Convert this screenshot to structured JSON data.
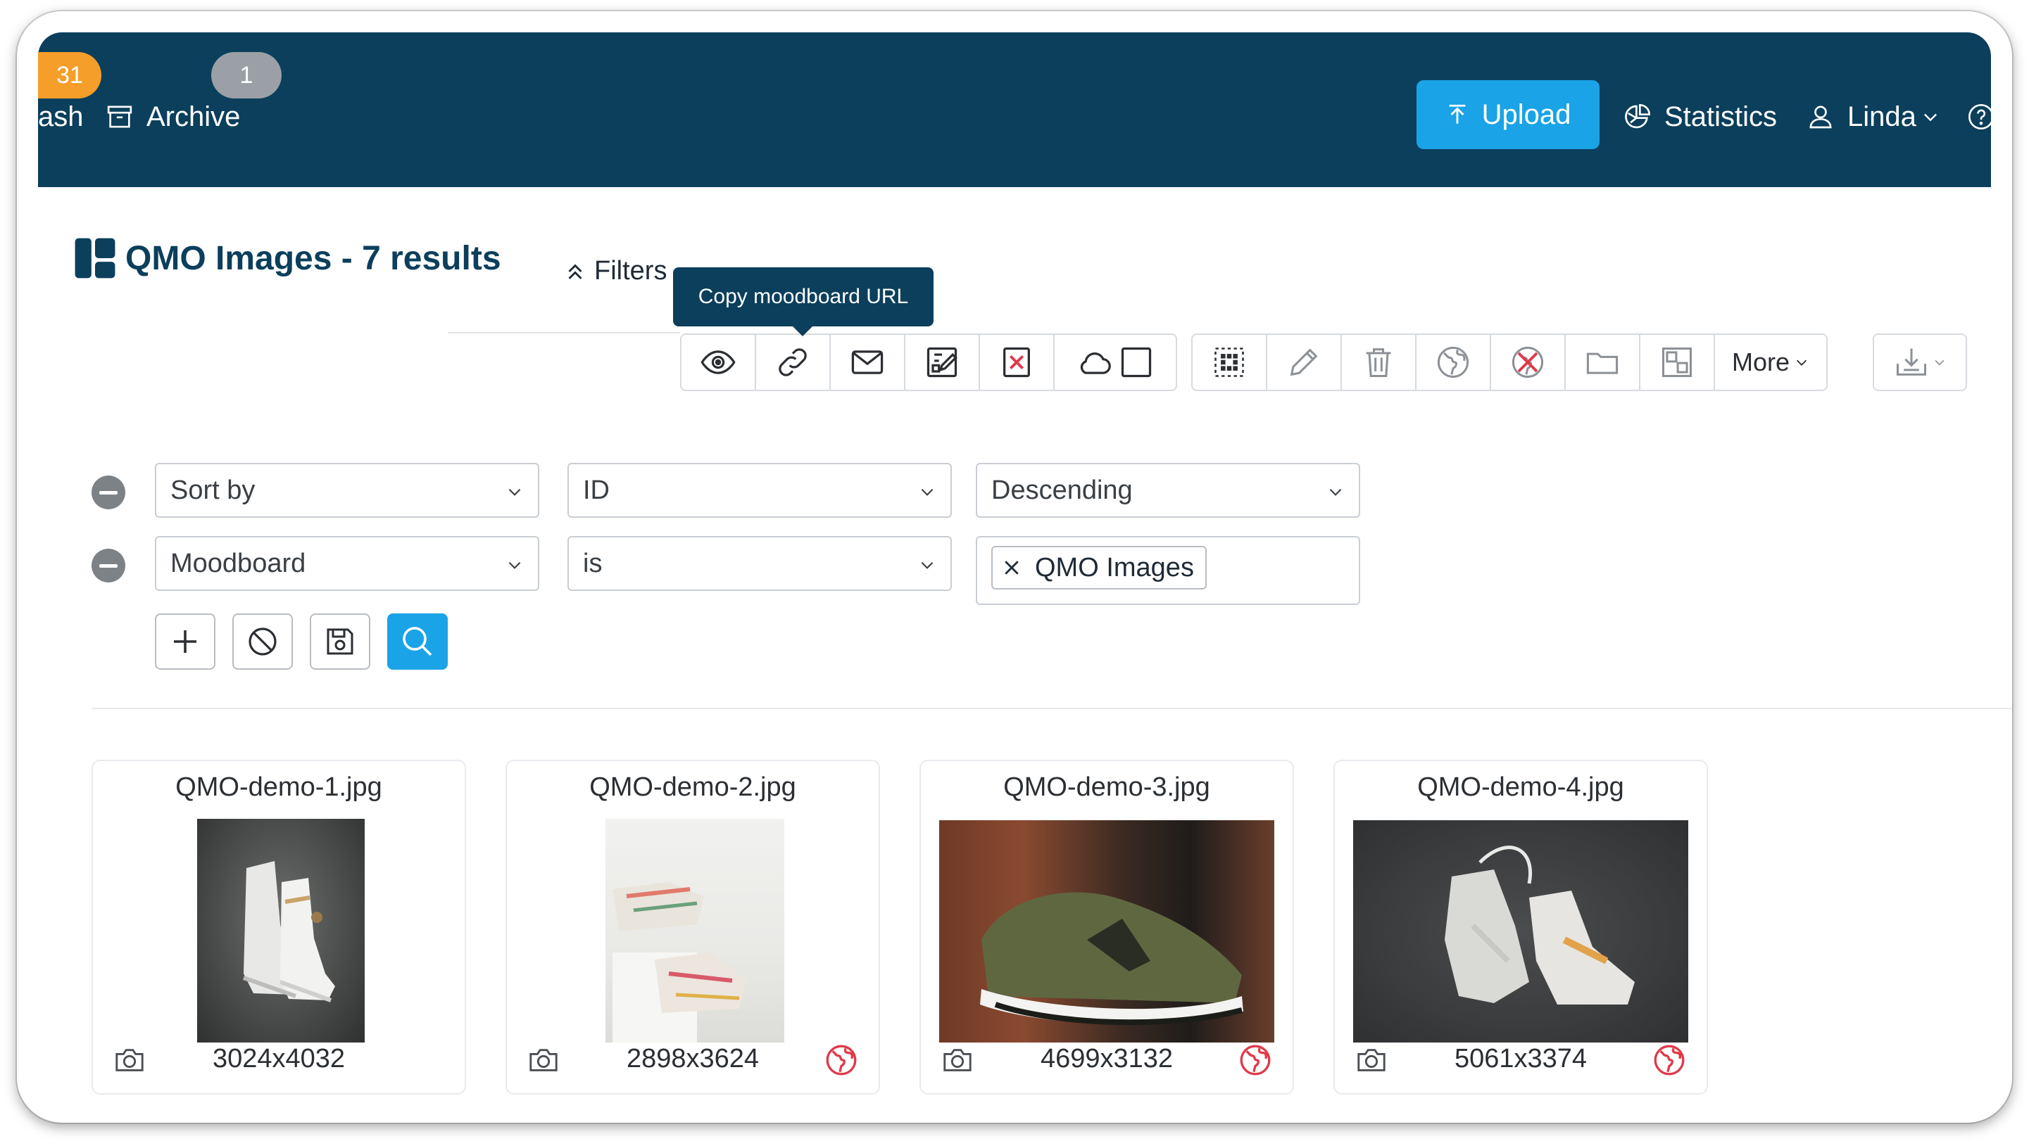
{
  "header": {
    "trash_count": "31",
    "trash_label": "ash",
    "archive_count": "1",
    "archive_label": "Archive",
    "upload_label": "Upload",
    "statistics_label": "Statistics",
    "user_label": "Linda",
    "colors": {
      "header_bg": "#0b3f5c",
      "accent": "#1aa3e6",
      "badge_orange": "#f59e2a"
    }
  },
  "page": {
    "title": "QMO Images - 7 results",
    "filters_label": "Filters",
    "tooltip": "Copy moodboard URL",
    "more_label": "More"
  },
  "sort_row": {
    "field": "Sort by",
    "value": "ID",
    "direction": "Descending"
  },
  "filter_row": {
    "field": "Moodboard",
    "operator": "is",
    "tag": "QMO Images"
  },
  "results": [
    {
      "name": "QMO-demo-1.jpg",
      "dimensions": "3024x4032",
      "public": false
    },
    {
      "name": "QMO-demo-2.jpg",
      "dimensions": "2898x3624",
      "public": true
    },
    {
      "name": "QMO-demo-3.jpg",
      "dimensions": "4699x3132",
      "public": true
    },
    {
      "name": "QMO-demo-4.jpg",
      "dimensions": "5061x3374",
      "public": true
    }
  ]
}
